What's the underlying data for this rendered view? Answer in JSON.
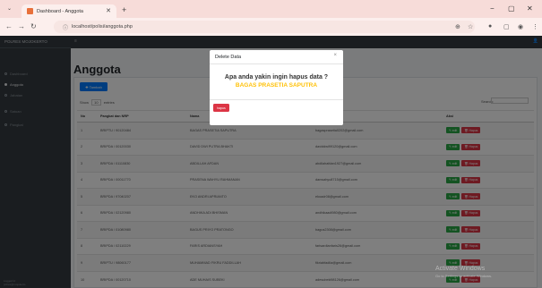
{
  "browser": {
    "tab_title": "Dashboard - Anggota",
    "url": "localhost/polisi/anggota.php",
    "controls": [
      "−",
      "▢",
      "✕"
    ]
  },
  "sidebar": {
    "brand": "POLRES MOJOKERTO",
    "items": [
      {
        "label": "Dashboard",
        "active": false
      },
      {
        "label": "Anggota",
        "active": true
      },
      {
        "label": "Jabatan",
        "active": false
      },
      {
        "label": "Satuan",
        "active": false
      },
      {
        "label": "Pangkat",
        "active": false
      }
    ],
    "footer_1": "Logged in:",
    "footer_2": "polres@mojokerto"
  },
  "page": {
    "title": "Anggota",
    "add_button": "✚ Tambah",
    "show_label_pre": "Show",
    "show_value": "10",
    "show_label_post": "entries",
    "search_label": "Search:"
  },
  "table": {
    "headers": [
      "No",
      "Pangkat dan NRP",
      "Nama",
      "Email",
      "Aksi"
    ],
    "edit_label": "✎ edit",
    "delete_label": "🗑 Hapus",
    "rows": [
      [
        "1",
        "BRIPTU / 90120484",
        "BAGAS PRASETIA SAPUTRA",
        "bagasprasetia0202@gmail.com"
      ],
      [
        "2",
        "BRIPDA / 00120030",
        "DAVID DWI PUTRA BHAKTI",
        "daviddwi99120@gmail.com"
      ],
      [
        "3",
        "BRIPDA / 01110830",
        "ABDILLAH AFDAN",
        "abdilahafdan1927@gmail.com"
      ],
      [
        "4",
        "BRIPDA / 00011770",
        "PRASENA WAHYU RAHMANAN",
        "danwahyu8715@gmail.com"
      ],
      [
        "5",
        "BRIPDA / 97040207",
        "EKO ANDRI APRIANTO",
        "ekoadr08@gmail.com"
      ],
      [
        "6",
        "BRIPDA / 02120980",
        "ANDHIKA ADI BHISMAN",
        "andhikaadi980@gmail.com"
      ],
      [
        "7",
        "BRIPDA / 01080980",
        "BAGUS PRIYO PRATONGO",
        "bagus2308@gmail.com"
      ],
      [
        "8",
        "BRIPDA / 02110229",
        "FARIS ARDIANSYAH",
        "farisardianfaris26@gmail.com"
      ],
      [
        "9",
        "BRIPTU / 98060177",
        "MUHAMMAD FIKRU FADDILLAH",
        "fikriabfadila@gmail.com"
      ],
      [
        "10",
        "BRIPDA / 00120710",
        "ADE MUHAIS SUBEKI",
        "adesubeki98126@gmail.com"
      ]
    ]
  },
  "modal": {
    "title": "Delete Data",
    "close": "×",
    "question": "Apa anda yakin ingin hapus data ?",
    "name": "BAGAS PRASETIA SAPUTRA",
    "confirm_label": "hapus"
  },
  "watermark": {
    "line1": "Activate Windows",
    "line2": "Go to Settings to activate Windows."
  },
  "colors": {
    "sidebar": "#343a40",
    "primary": "#007bff",
    "success": "#28a745",
    "danger": "#dc3545",
    "warning": "#ffc107"
  }
}
